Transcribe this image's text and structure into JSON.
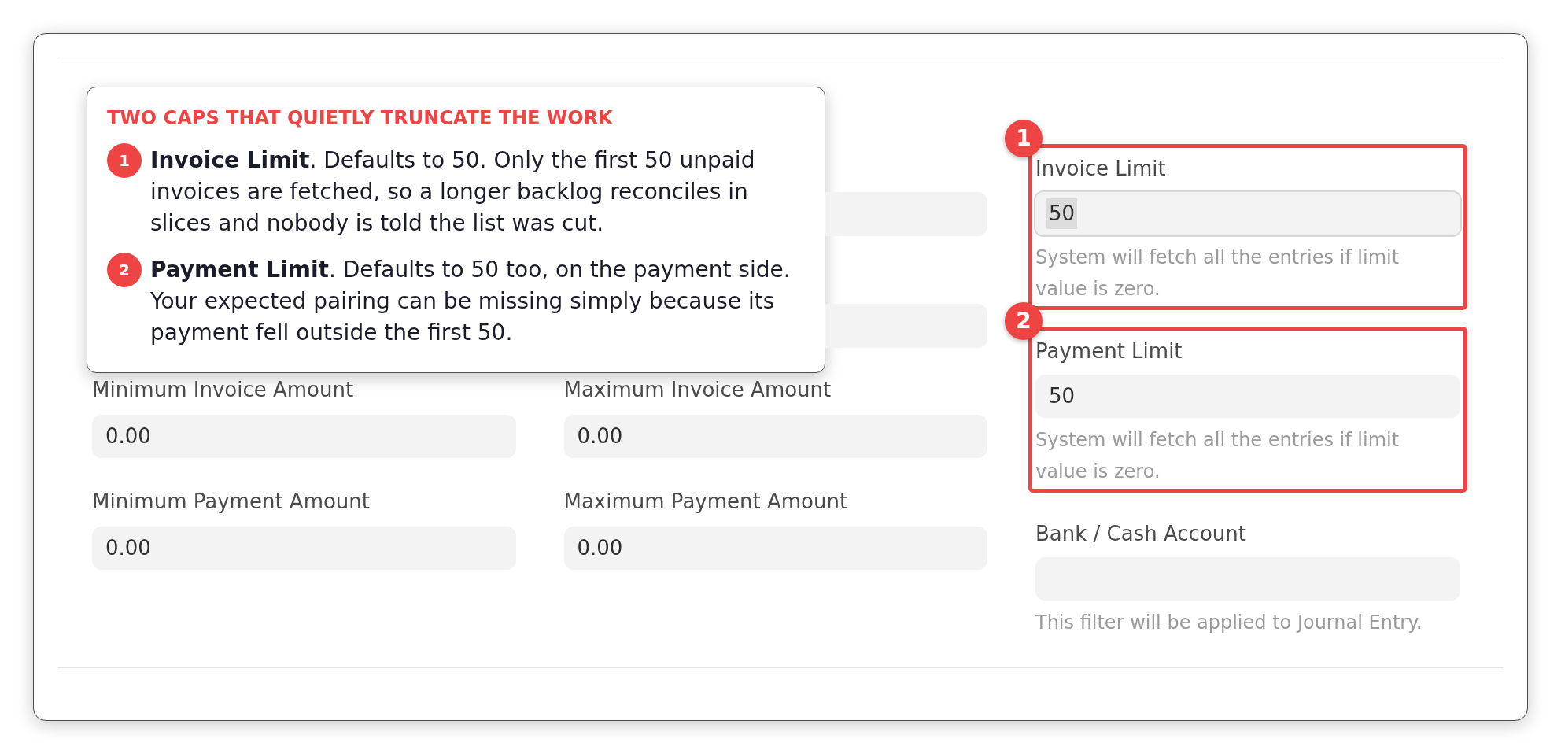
{
  "callout": {
    "title": "TWO CAPS THAT QUIETLY TRUNCATE THE WORK",
    "items": [
      {
        "number": "1",
        "text": "**Invoice Limit**. Defaults to 50. Only the first 50 unpaid invoices are fetched, so a longer backlog reconciles in slices and nobody is told the list was cut."
      },
      {
        "number": "2",
        "text": "**Payment Limit**. Defaults to 50 too, on the payment side. Your expected pairing can be missing simply because its payment fell outside the first 50."
      }
    ]
  },
  "form": {
    "amount_fields": [
      {
        "label": "Minimum Invoice Amount",
        "value": "0.00"
      },
      {
        "label": "Maximum Invoice Amount",
        "value": "0.00"
      },
      {
        "label": "Minimum Payment Amount",
        "value": "0.00"
      },
      {
        "label": "Maximum Payment Amount",
        "value": "0.00"
      }
    ],
    "limit_fields": [
      {
        "label": "Invoice Limit",
        "value": "50",
        "hint": "System will fetch all the entries if limit value is zero.",
        "focused": true,
        "marker": "1"
      },
      {
        "label": "Payment Limit",
        "value": "50",
        "hint": "System will fetch all the entries if limit value is zero.",
        "focused": false,
        "marker": "2"
      },
      {
        "label": "Bank / Cash Account",
        "hint": "This filter will be applied to Journal Entry.",
        "focused": false
      }
    ]
  }
}
